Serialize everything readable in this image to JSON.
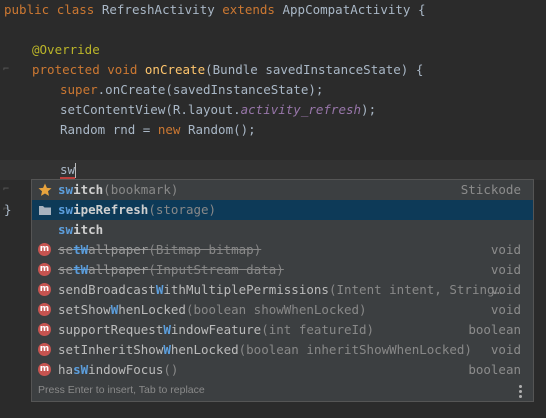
{
  "editor": {
    "line1": {
      "kw1": "public",
      "kw2": "class",
      "name": "RefreshActivity",
      "kw3": "extends",
      "parent": "AppCompatActivity",
      "brace": "{"
    },
    "line3": {
      "annotation": "@Override"
    },
    "line4": {
      "kw1": "protected",
      "kw2": "void",
      "method": "onCreate",
      "params": "(Bundle savedInstanceState) {"
    },
    "line5": {
      "kw": "super",
      "rest": ".onCreate(savedInstanceState);"
    },
    "line6": {
      "a": "setContentView(R.layout.",
      "field": "activity_refresh",
      "b": ");"
    },
    "line7": {
      "a": "Random ",
      "var": "rnd",
      "b": " = ",
      "kw": "new",
      "c": " Random();"
    },
    "line9": {
      "typed": "sw"
    },
    "line11": {
      "brace": "}"
    }
  },
  "completion": {
    "items": [
      {
        "icon": "bookmark-star-icon",
        "match": "sw",
        "rest": "itch",
        "hint": "(bookmark)",
        "type": "Stickode"
      },
      {
        "icon": "folder-icon",
        "match": "sw",
        "rest": "ipeRefresh",
        "hint": "(storage)",
        "type": ""
      },
      {
        "icon": "",
        "match": "sw",
        "rest": "itch",
        "hint": "",
        "type": ""
      },
      {
        "icon": "method-icon",
        "pre": "se",
        "match": "tW",
        "rest": "allpaper",
        "hint": "(Bitmap bitmap)",
        "type": "void"
      },
      {
        "icon": "method-icon",
        "pre": "se",
        "match": "tW",
        "rest": "allpaper",
        "hint": "(InputStream data)",
        "type": "void"
      },
      {
        "icon": "method-icon",
        "pre": "sendBroadcast",
        "match": "W",
        "rest": "ithMultiplePermissions",
        "hint": "(Intent intent, String…",
        "type": "void"
      },
      {
        "icon": "method-icon",
        "pre": "setShow",
        "match": "W",
        "rest": "henLocked",
        "hint": "(boolean showWhenLocked)",
        "type": "void"
      },
      {
        "icon": "method-icon",
        "pre": "supportRequest",
        "match": "W",
        "rest": "indowFeature",
        "hint": "(int featureId)",
        "type": "boolean"
      },
      {
        "icon": "method-icon",
        "pre": "setInheritShow",
        "match": "W",
        "rest": "henLocked",
        "hint": "(boolean inheritShowWhenLocked)",
        "type": "void"
      },
      {
        "icon": "method-icon",
        "pre": "ha",
        "match": "sW",
        "rest": "indowFocus",
        "hint": "()",
        "type": "boolean"
      }
    ],
    "method_icon_letter": "m",
    "footer": "Press Enter to insert, Tab to replace",
    "colors": {
      "selected_bg": "#0d3a58",
      "match": "#5c9fde",
      "method_icon": "#c75450",
      "star": "#e8a33d"
    }
  }
}
